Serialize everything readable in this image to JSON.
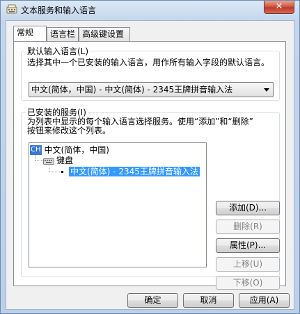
{
  "window": {
    "title": "文本服务和输入语言",
    "close_glyph": "✕"
  },
  "tabs": [
    {
      "label": "常规",
      "active": true
    },
    {
      "label": "语言栏",
      "active": false
    },
    {
      "label": "高级键设置",
      "active": false
    }
  ],
  "default_language": {
    "group_title": "默认输入语言(L)",
    "description": "选择其中一个已安装的输入语言，用作所有输入字段的默认语言。",
    "selected_value": "中文(简体，中国) - 中文(简体) - 2345王牌拼音输入法"
  },
  "installed_services": {
    "group_title": "已安装的服务(I)",
    "description_line1": "为列表中显示的每个输入语言选择服务。使用“添加”和“删除”",
    "description_line2": "按钮来修改这个列表。",
    "tree": {
      "language_badge": "CH",
      "language": "中文(简体，中国)",
      "category": "键盘",
      "service": "中文(简体) - 2345王牌拼音输入法"
    },
    "buttons": {
      "add": "添加(D)...",
      "remove": "删除(R)",
      "properties": "属性(P)...",
      "move_up": "上移(U)",
      "move_down": "下移(O)"
    }
  },
  "footer": {
    "ok": "确定",
    "cancel": "取消",
    "apply": "应用(A)"
  }
}
